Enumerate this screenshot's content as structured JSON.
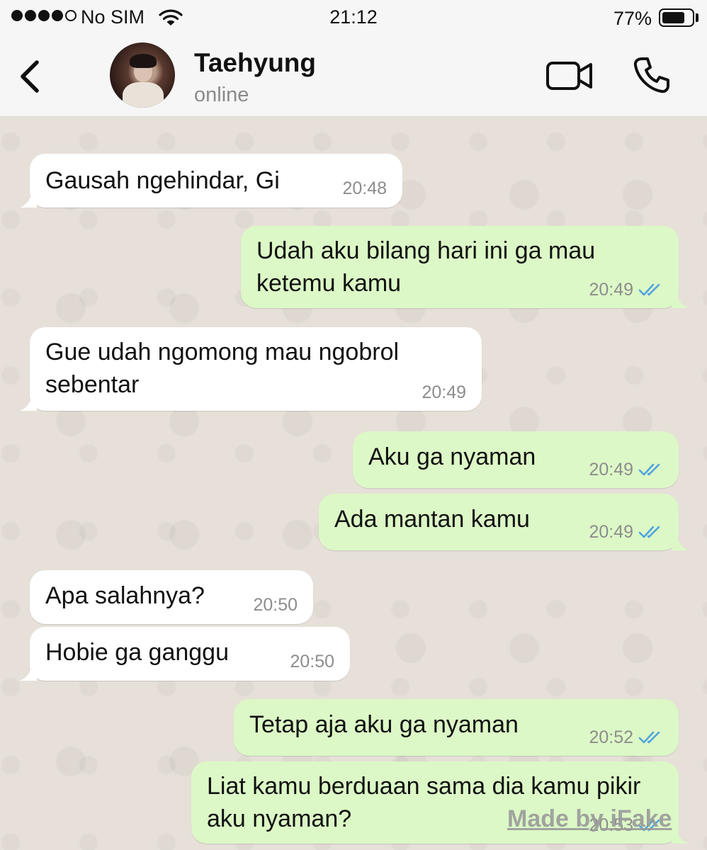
{
  "status_bar": {
    "carrier": "No SIM",
    "time": "21:12",
    "battery": "77%",
    "battery_level": 0.77
  },
  "header": {
    "contact_name": "Taehyung",
    "contact_status": "online",
    "icons": [
      "back-chevron-icon",
      "video-call-icon",
      "phone-call-icon"
    ]
  },
  "messages": [
    {
      "direction": "incoming",
      "text": "Gausah ngehindar, Gi",
      "time": "20:48"
    },
    {
      "direction": "outgoing",
      "text": "Udah aku bilang hari ini ga mau ketemu kamu",
      "time": "20:49",
      "status": "read"
    },
    {
      "direction": "incoming",
      "text": "Gue udah ngomong mau ngobrol sebentar",
      "time": "20:49"
    },
    {
      "direction": "outgoing",
      "text": "Aku ga nyaman",
      "time": "20:49",
      "status": "read"
    },
    {
      "direction": "outgoing",
      "text": "Ada mantan kamu",
      "time": "20:49",
      "status": "read"
    },
    {
      "direction": "incoming",
      "text": "Apa salahnya?",
      "time": "20:50"
    },
    {
      "direction": "incoming",
      "text": "Hobie ga ganggu",
      "time": "20:50"
    },
    {
      "direction": "outgoing",
      "text": "Tetap aja aku ga nyaman",
      "time": "20:52",
      "status": "read"
    },
    {
      "direction": "outgoing",
      "text": "Liat kamu berduaan sama dia kamu pikir aku nyaman?",
      "time": "20:53",
      "status": "read"
    }
  ],
  "watermark": "Made by iFake",
  "colors": {
    "incoming_bubble": "#ffffff",
    "outgoing_bubble": "#dcf8c6",
    "read_ticks": "#4fa3e0",
    "chat_background": "#e6e0d9",
    "header_background": "#f6f6f6"
  }
}
